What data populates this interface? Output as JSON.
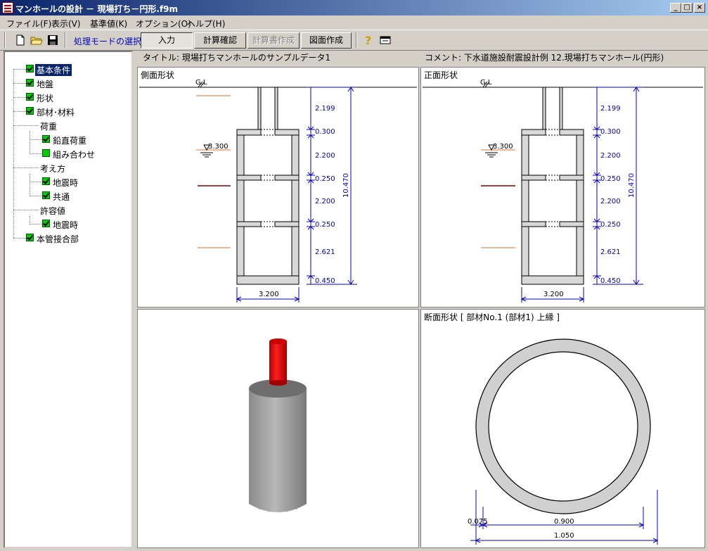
{
  "window": {
    "title": "マンホールの設計 － 現場打ち－円形.f9m",
    "minimize": "_",
    "maximize": "□",
    "close": "×"
  },
  "menu": [
    "ファイル(F)",
    "表示(V)",
    "基準値(K)",
    "オプション(O)",
    "ヘルプ(H)"
  ],
  "toolbar": {
    "mode_label": "処理モードの選択",
    "buttons": [
      "入力",
      "計算確認",
      "計算書作成",
      "図面作成"
    ],
    "icons": [
      "new-file-icon",
      "open-folder-icon",
      "save-disk-icon",
      "help-question-icon",
      "window-icon"
    ]
  },
  "tree": {
    "items": [
      {
        "label": "基本条件",
        "checked": true,
        "selected": true
      },
      {
        "label": "地盤",
        "checked": true
      },
      {
        "label": "形状",
        "checked": true
      },
      {
        "label": "部材･材料",
        "checked": true
      },
      {
        "label": "荷重",
        "group": true
      },
      {
        "label": "鉛直荷重",
        "checked": true
      },
      {
        "label": "組み合わせ",
        "checked": false
      },
      {
        "label": "考え方",
        "group": true
      },
      {
        "label": "地震時",
        "checked": true
      },
      {
        "label": "共通",
        "checked": true
      },
      {
        "label": "許容値",
        "group": true
      },
      {
        "label": "地震時",
        "checked": true
      },
      {
        "label": "本管接合部",
        "checked": true
      }
    ]
  },
  "header": {
    "title": "タイトル: 現場打ちマンホールのサンプルデータ1",
    "comment": "コメント: 下水道施設耐震設計例 12.現場打ちマンホール(円形)"
  },
  "panels": {
    "side": {
      "title": "側面形状",
      "gl": "G.L",
      "water_level": "3.300",
      "dims": [
        "2.199",
        "0.300",
        "2.200",
        "0.250",
        "2.200",
        "0.250",
        "2.621",
        "0.450"
      ],
      "total": "10.470",
      "width": "3.200"
    },
    "front": {
      "title": "正面形状",
      "gl": "G.L",
      "water_level": "3.300",
      "dims": [
        "2.199",
        "0.300",
        "2.200",
        "0.250",
        "2.200",
        "0.250",
        "2.621",
        "0.450"
      ],
      "total": "10.470",
      "width": "3.200"
    },
    "view3d": {},
    "section": {
      "title": "断面形状 [ 部材No.1 (部材1) 上縁 ]",
      "thickness": "0.075",
      "inner": "0.900",
      "outer": "1.050"
    }
  },
  "colors": {
    "dim_line": "#0000c0",
    "ground_line": "#e07030",
    "dark_line": "#800000",
    "shaft": "#cc0000",
    "body": "#a0a0a0"
  }
}
